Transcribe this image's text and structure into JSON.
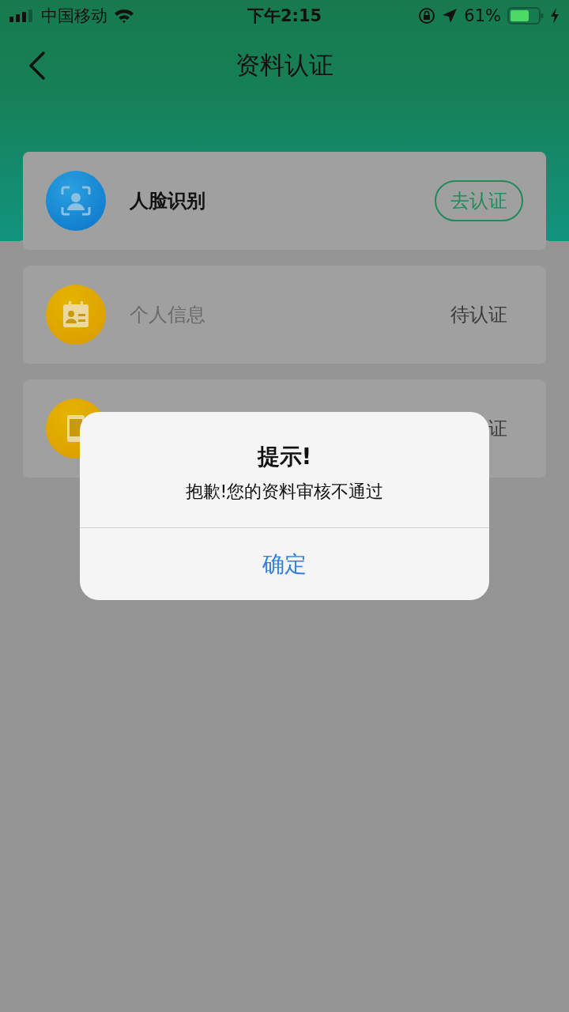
{
  "status_bar": {
    "carrier": "中国移动",
    "time": "下午2:15",
    "battery": "61%"
  },
  "nav": {
    "title": "资料认证"
  },
  "items": [
    {
      "label": "人脸识别",
      "disabled": false,
      "kind": "button",
      "action": "去认证"
    },
    {
      "label": "个人信息",
      "disabled": true,
      "kind": "status",
      "action": "待认证"
    },
    {
      "kind": "status",
      "action": "证"
    }
  ],
  "dialog": {
    "title": "提示!",
    "message": "抱歉!您的资料审核不通过",
    "button": "确定"
  }
}
